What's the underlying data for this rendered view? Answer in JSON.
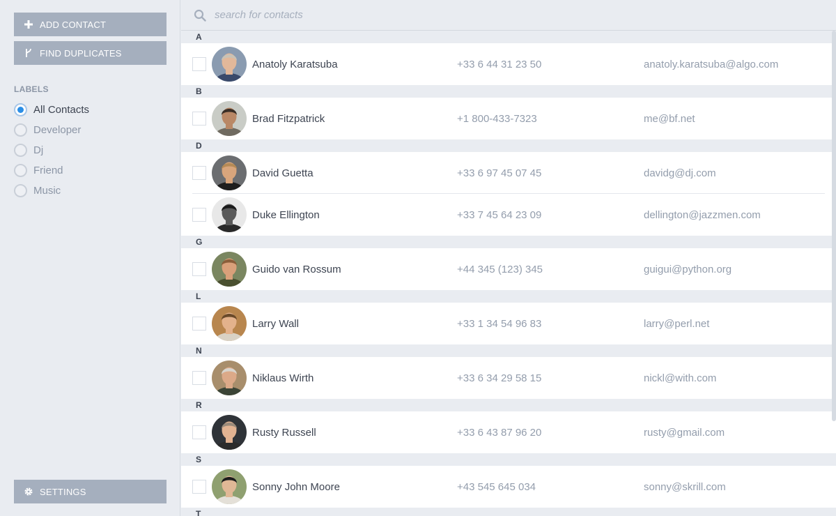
{
  "sidebar": {
    "add_contact": "ADD CONTACT",
    "find_duplicates": "FIND DUPLICATES",
    "labels_title": "LABELS",
    "labels": [
      {
        "label": "All Contacts",
        "selected": true
      },
      {
        "label": "Developer",
        "selected": false
      },
      {
        "label": "Dj",
        "selected": false
      },
      {
        "label": "Friend",
        "selected": false
      },
      {
        "label": "Music",
        "selected": false
      }
    ],
    "settings": "SETTINGS"
  },
  "search": {
    "placeholder": "search for contacts",
    "value": ""
  },
  "sections": [
    {
      "letter": "A",
      "contacts": [
        {
          "name": "Anatoly Karatsuba",
          "phone": "+33 6 44 31 23 50",
          "email": "anatoly.karatsuba@algo.com",
          "avatar": {
            "bg": "#8a9bb0",
            "skin": "#e2b89a",
            "hair": "#c9c2b5",
            "shirt": "#3a4a6b"
          }
        }
      ]
    },
    {
      "letter": "B",
      "contacts": [
        {
          "name": "Brad Fitzpatrick",
          "phone": "+1 800-433-7323",
          "email": "me@bf.net",
          "avatar": {
            "bg": "#c9ccc6",
            "skin": "#b98866",
            "hair": "#3a2e26",
            "shirt": "#6f6a60"
          }
        }
      ]
    },
    {
      "letter": "D",
      "contacts": [
        {
          "name": "David Guetta",
          "phone": "+33 6 97 45 07 45",
          "email": "davidg@dj.com",
          "avatar": {
            "bg": "#6b6d70",
            "skin": "#d8a57c",
            "hair": "#b58a56",
            "shirt": "#1e1e1e"
          }
        },
        {
          "name": "Duke Ellington",
          "phone": "+33 7 45 64 23 09",
          "email": "dellington@jazzmen.com",
          "avatar": {
            "bg": "#e8e8e8",
            "skin": "#5a5a5a",
            "hair": "#1a1a1a",
            "shirt": "#2a2a2a"
          }
        }
      ]
    },
    {
      "letter": "G",
      "contacts": [
        {
          "name": "Guido van Rossum",
          "phone": "+44 345 (123) 345",
          "email": "guigui@python.org",
          "avatar": {
            "bg": "#7a8660",
            "skin": "#d9a07a",
            "hair": "#8a5e3a",
            "shirt": "#4a5030"
          }
        }
      ]
    },
    {
      "letter": "L",
      "contacts": [
        {
          "name": "Larry Wall",
          "phone": "+33 1 34 54 96 83",
          "email": "larry@perl.net",
          "avatar": {
            "bg": "#b8864e",
            "skin": "#e3b28c",
            "hair": "#6a4a2a",
            "shirt": "#d9d2c5"
          }
        }
      ]
    },
    {
      "letter": "N",
      "contacts": [
        {
          "name": "Niklaus Wirth",
          "phone": "+33 6 34 29 58 15",
          "email": "nickl@with.com",
          "avatar": {
            "bg": "#a88e6c",
            "skin": "#dca988",
            "hair": "#d8d4cc",
            "shirt": "#3b4436"
          }
        }
      ]
    },
    {
      "letter": "R",
      "contacts": [
        {
          "name": "Rusty Russell",
          "phone": "+33 6 43 87 96 20",
          "email": "rusty@gmail.com",
          "avatar": {
            "bg": "#2f3338",
            "skin": "#e2b392",
            "hair": "#9a8a7a",
            "shirt": "#2b2b2b"
          }
        }
      ]
    },
    {
      "letter": "S",
      "contacts": [
        {
          "name": "Sonny John Moore",
          "phone": "+43 545 645 034",
          "email": "sonny@skrill.com",
          "avatar": {
            "bg": "#8fa070",
            "skin": "#e0b896",
            "hair": "#1c1c1c",
            "shirt": "#e4e0d8"
          }
        }
      ]
    },
    {
      "letter": "T",
      "contacts": []
    }
  ]
}
